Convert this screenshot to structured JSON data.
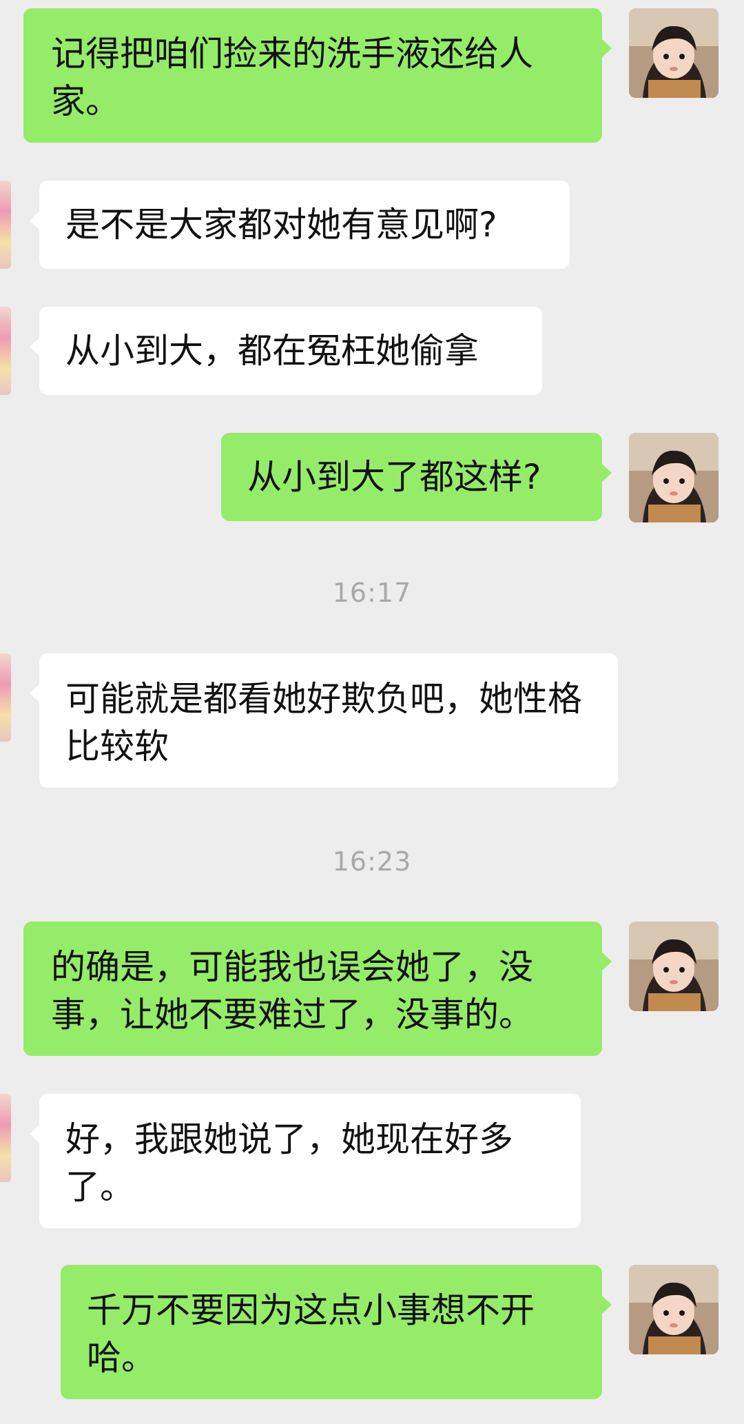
{
  "messages": [
    {
      "text": "记得把咱们捡来的洗手液还给人家。"
    },
    {
      "text": "是不是大家都对她有意见啊?"
    },
    {
      "text": "从小到大，都在冤枉她偷拿"
    },
    {
      "text": "从小到大了都这样?"
    },
    {
      "text": "可能就是都看她好欺负吧，她性格比较软"
    },
    {
      "text": "的确是，可能我也误会她了，没事，让她不要难过了，没事的。"
    },
    {
      "text": "好，我跟她说了，她现在好多了。"
    },
    {
      "text": "千万不要因为这点小事想不开哈。"
    }
  ],
  "timestamps": [
    "16:17",
    "16:23"
  ],
  "colors": {
    "outgoing_bubble": "#95ec69",
    "incoming_bubble": "#ffffff",
    "background": "#ededed",
    "timestamp": "#a8a8a8"
  }
}
